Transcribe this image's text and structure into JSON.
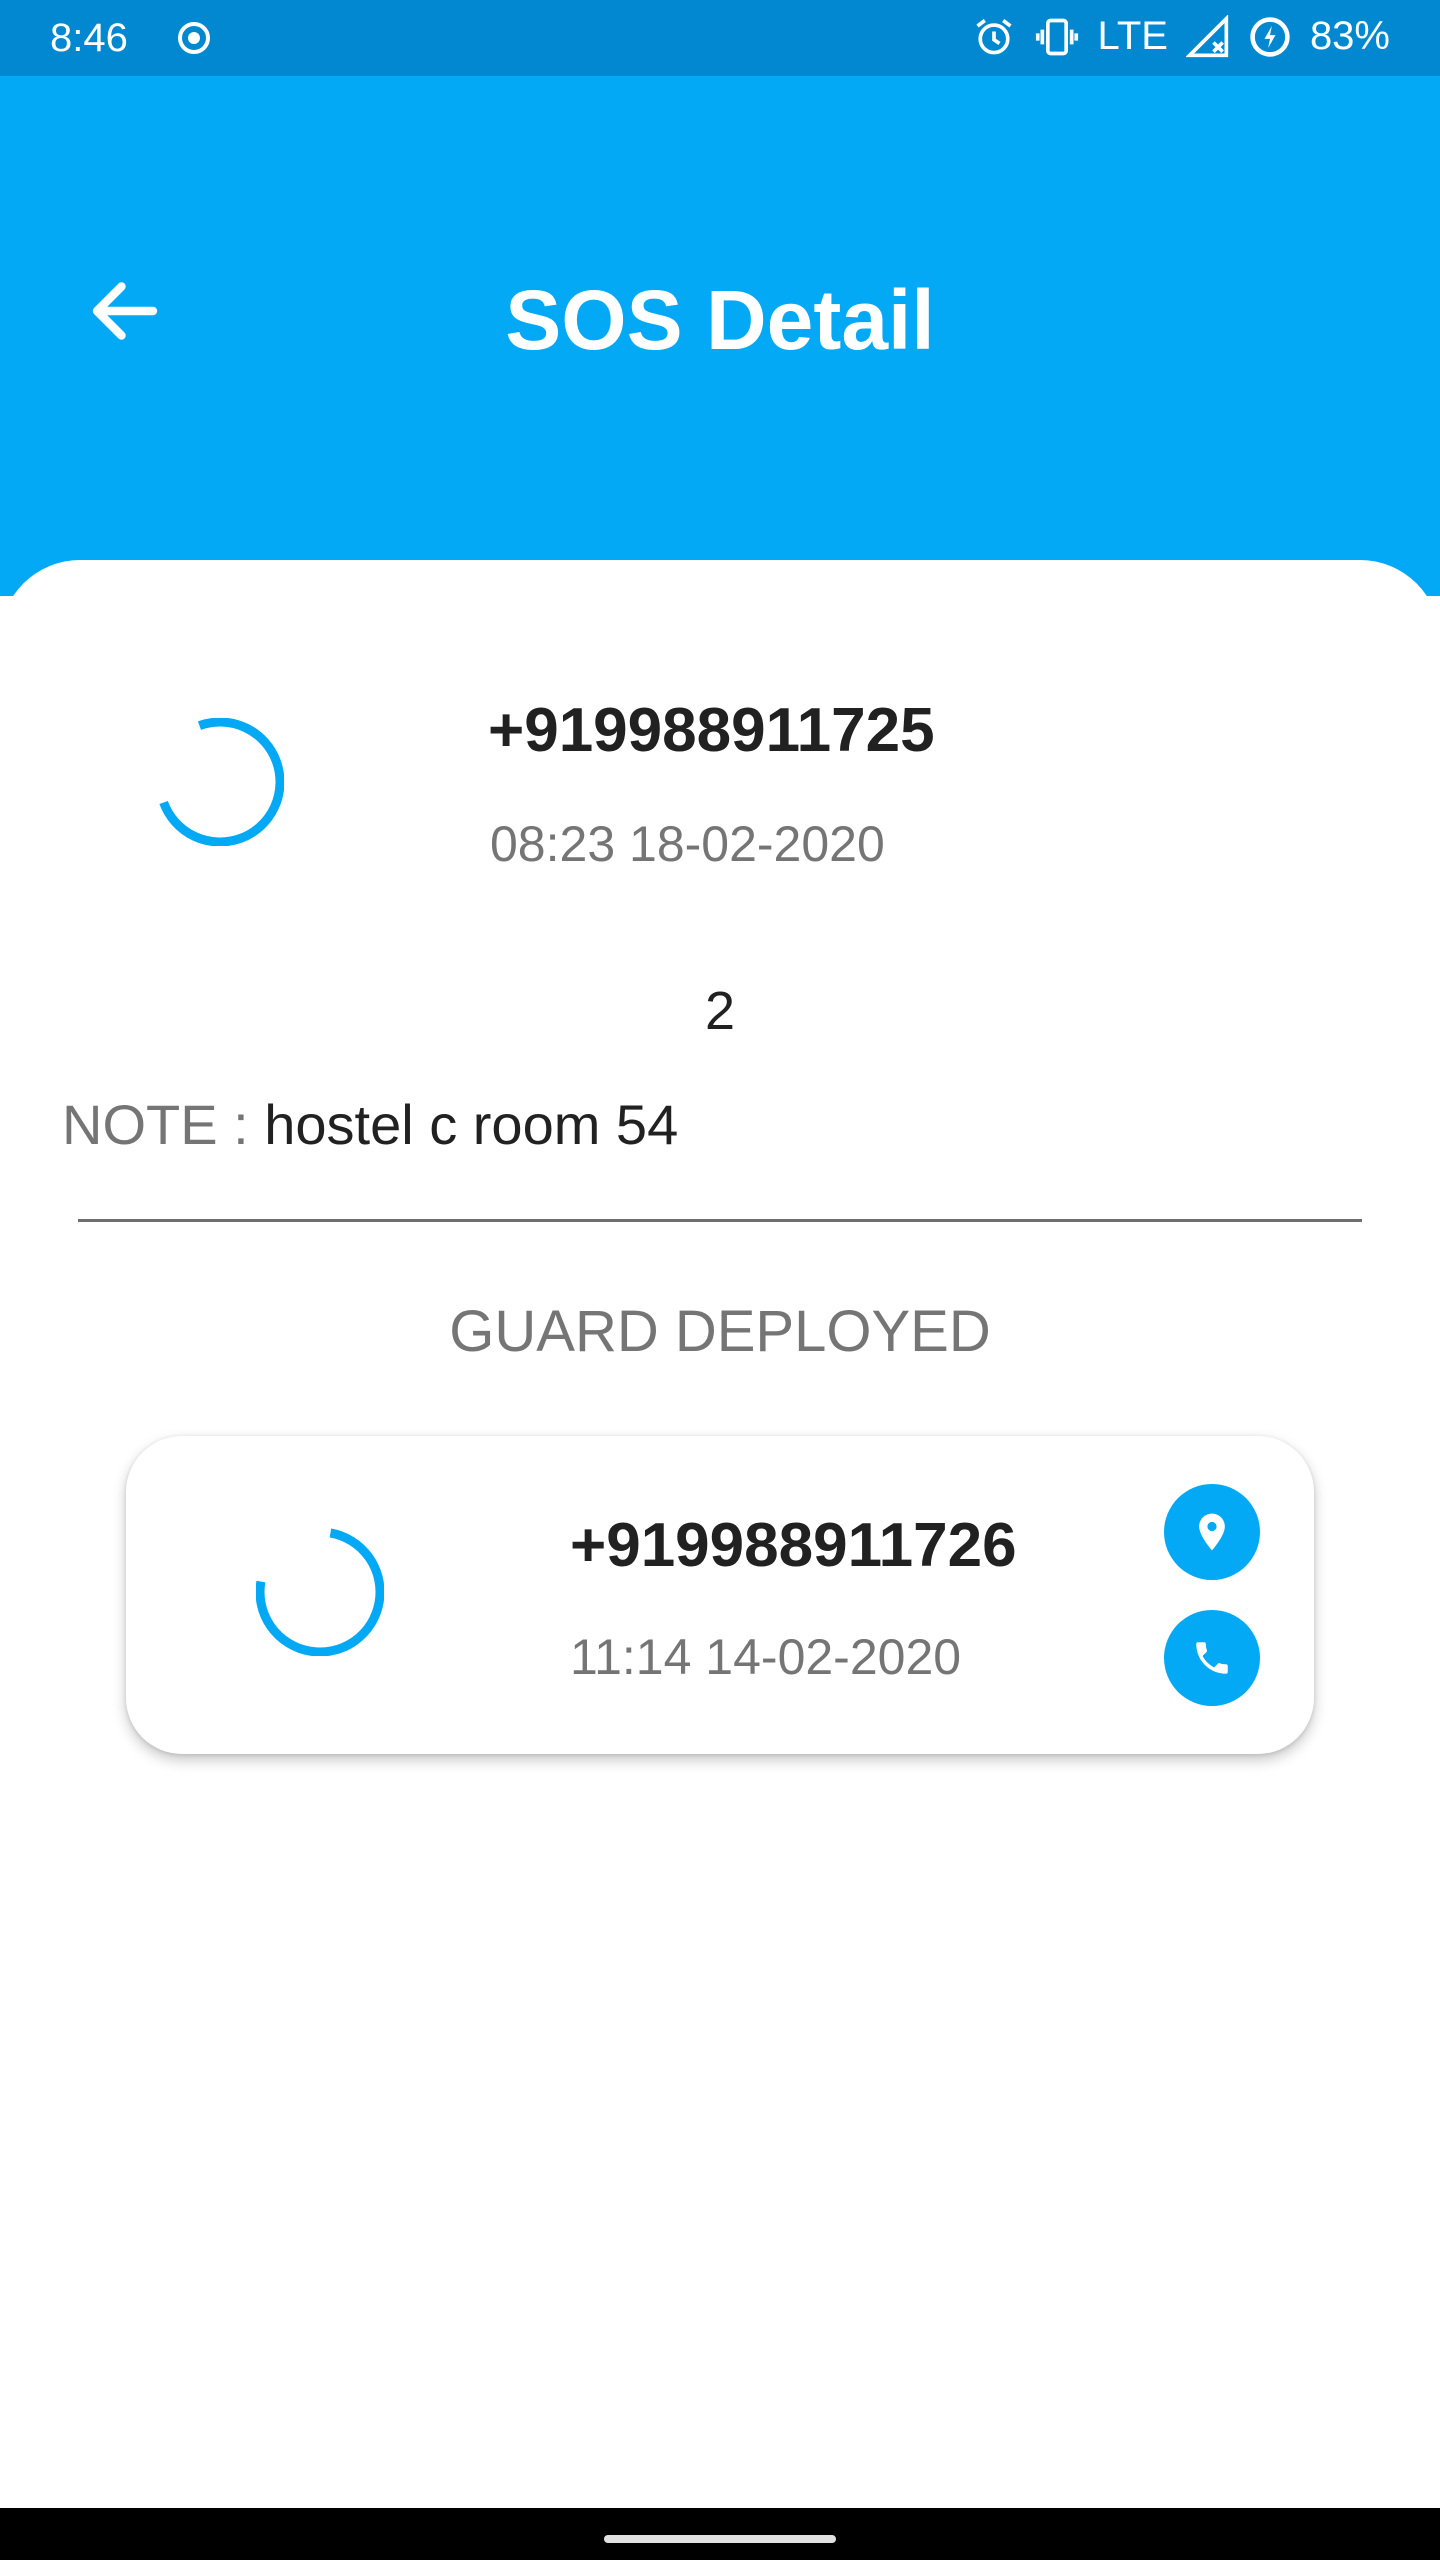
{
  "status_bar": {
    "time": "8:46",
    "network": "LTE",
    "battery": "83%",
    "icons": [
      "record-icon",
      "alarm-icon",
      "vibrate-icon",
      "signal-icon",
      "battery-saver-icon"
    ]
  },
  "app_bar": {
    "title": "SOS Detail",
    "back_icon": "arrow-back-icon",
    "color": "#03a9f4"
  },
  "sos": {
    "phone": "+919988911725",
    "timestamp": "08:23 18-02-2020",
    "count": "2",
    "note_label": "NOTE : ",
    "note_value": "hostel c room 54"
  },
  "guard_section": {
    "heading": "GUARD DEPLOYED",
    "guards": [
      {
        "phone": "+919988911726",
        "timestamp": "11:14 14-02-2020",
        "actions": [
          "location-pin-icon",
          "phone-icon"
        ]
      }
    ]
  },
  "colors": {
    "accent": "#03a9f4",
    "status_bar": "#0288d1",
    "text_primary": "#212121",
    "text_secondary": "#757575"
  }
}
